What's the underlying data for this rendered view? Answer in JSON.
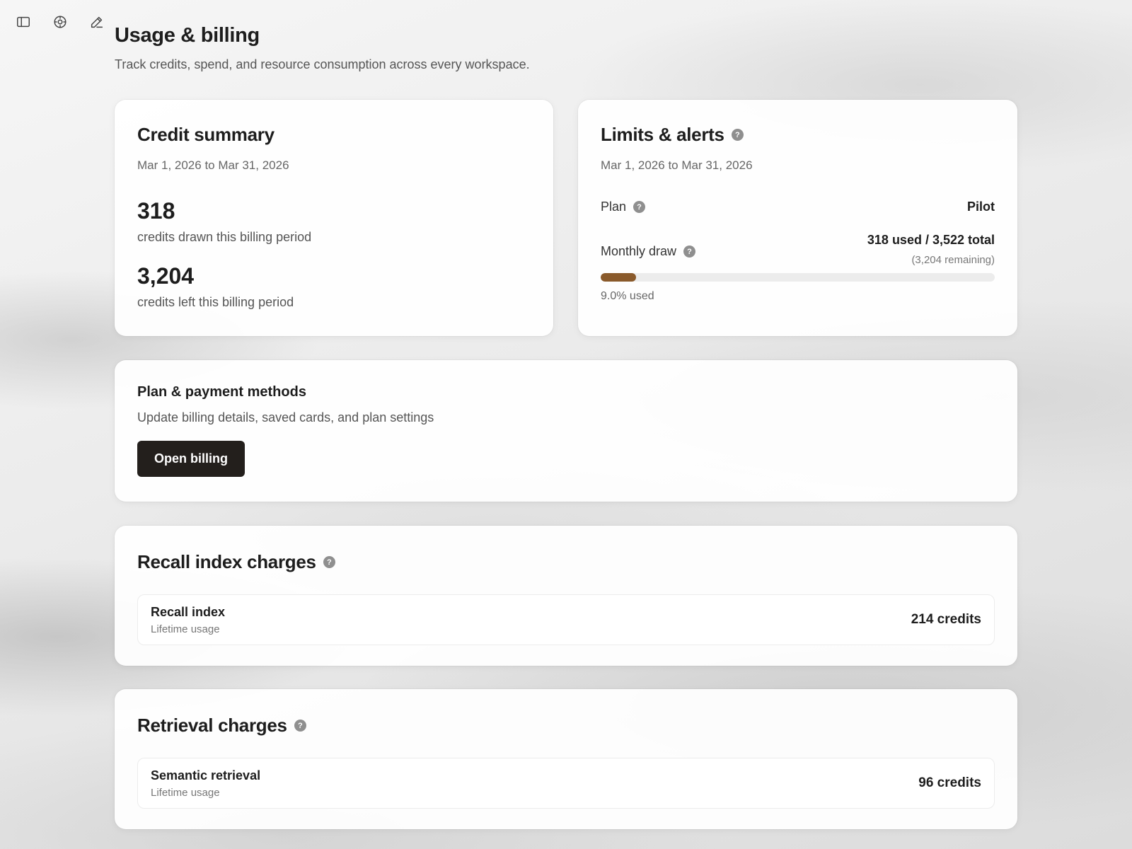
{
  "toolbar": {
    "icons": [
      "sidebar-toggle-icon",
      "target-icon",
      "edit-pencil-icon"
    ]
  },
  "page": {
    "title": "Usage & billing",
    "subtitle": "Track credits, spend, and resource consumption across every workspace."
  },
  "credit_summary": {
    "title": "Credit summary",
    "date_range": "Mar 1, 2026 to Mar 31, 2026",
    "drawn_value": "318",
    "drawn_label": "credits drawn this billing period",
    "left_value": "3,204",
    "left_label": "credits left this billing period"
  },
  "limits": {
    "title": "Limits & alerts",
    "date_range": "Mar 1, 2026 to Mar 31, 2026",
    "plan_label": "Plan",
    "plan_value": "Pilot",
    "draw_label": "Monthly draw",
    "draw_total": "318 used / 3,522 total",
    "draw_remaining": "(3,204 remaining)",
    "progress_percent": 9.0,
    "progress_text": "9.0% used",
    "progress_color": "#8a5a2b"
  },
  "plan_payment": {
    "title": "Plan & payment methods",
    "description": "Update billing details, saved cards, and plan settings",
    "button_label": "Open billing"
  },
  "recall": {
    "title": "Recall index charges",
    "item_name": "Recall index",
    "item_sub": "Lifetime usage",
    "item_credits": "214 credits"
  },
  "retrieval": {
    "title": "Retrieval charges",
    "item_name": "Semantic retrieval",
    "item_sub": "Lifetime usage",
    "item_credits": "96 credits"
  },
  "help_glyph": "?"
}
